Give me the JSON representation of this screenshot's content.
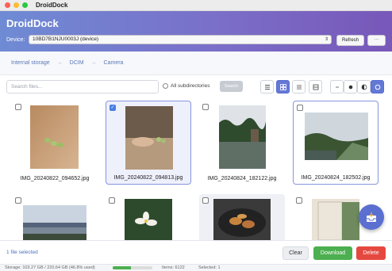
{
  "window": {
    "title": "DroidDock"
  },
  "header": {
    "app_title": "DroidDock",
    "device_label": "Device:",
    "device_selected": "10BD7B1NJU0003J (device)",
    "refresh_label": "Refresh",
    "more_label": "···"
  },
  "breadcrumb": [
    "Internal storage",
    "DCIM",
    "Camera"
  ],
  "toolbar": {
    "search_placeholder": "Search files...",
    "subdir_label": "All subdirectories",
    "search_button": "Search"
  },
  "files": [
    {
      "name": "IMG_20240822_094652.jpg",
      "selected": false
    },
    {
      "name": "IMG_20240822_094813.jpg",
      "selected": true
    },
    {
      "name": "IMG_20240824_182122.jpg",
      "selected": false
    },
    {
      "name": "IMG_20240824_182502.jpg",
      "selected": false
    },
    {
      "name": "",
      "selected": false
    },
    {
      "name": "",
      "selected": false
    },
    {
      "name": "",
      "selected": false
    },
    {
      "name": "",
      "selected": false
    }
  ],
  "footer": {
    "selected_count": "1 file selected",
    "clear_label": "Clear",
    "download_label": "Download",
    "delete_label": "Delete"
  },
  "status": {
    "storage": "Storage:  103.27 GB / 220.64 GB (46.8% used)",
    "storage_used_fraction": 0.468,
    "items": "Items:  6122",
    "selected": "Selected:  1"
  },
  "colors": {
    "accent": "#6478d6",
    "download": "#4caf50",
    "delete": "#e5483f"
  }
}
